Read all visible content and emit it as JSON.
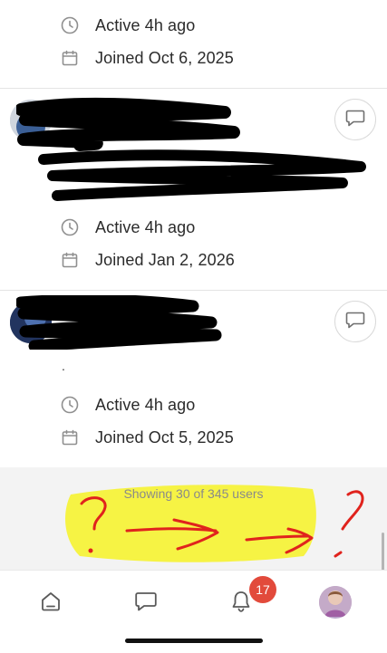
{
  "users": [
    {
      "active": "Active 4h ago",
      "joined": "Joined Oct 6, 2025"
    },
    {
      "active": "Active 4h ago",
      "joined": "Joined Jan 2, 2026"
    },
    {
      "active": "Active 4h ago",
      "joined": "Joined Oct 5, 2025",
      "bio_fragment": "."
    }
  ],
  "footer": {
    "showing": "Showing 30 of 345 users"
  },
  "tabbar": {
    "items": [
      "home-icon",
      "chat-icon",
      "bell-icon",
      "profile-avatar"
    ],
    "notification_count": "17"
  },
  "annotation": {
    "marks": [
      "?",
      "→",
      "→",
      "?"
    ],
    "highlight_color": "#f5f23a",
    "ink_color": "#e0231d"
  },
  "colors": {
    "badge": "#e24a3b",
    "redaction": "#000000"
  }
}
